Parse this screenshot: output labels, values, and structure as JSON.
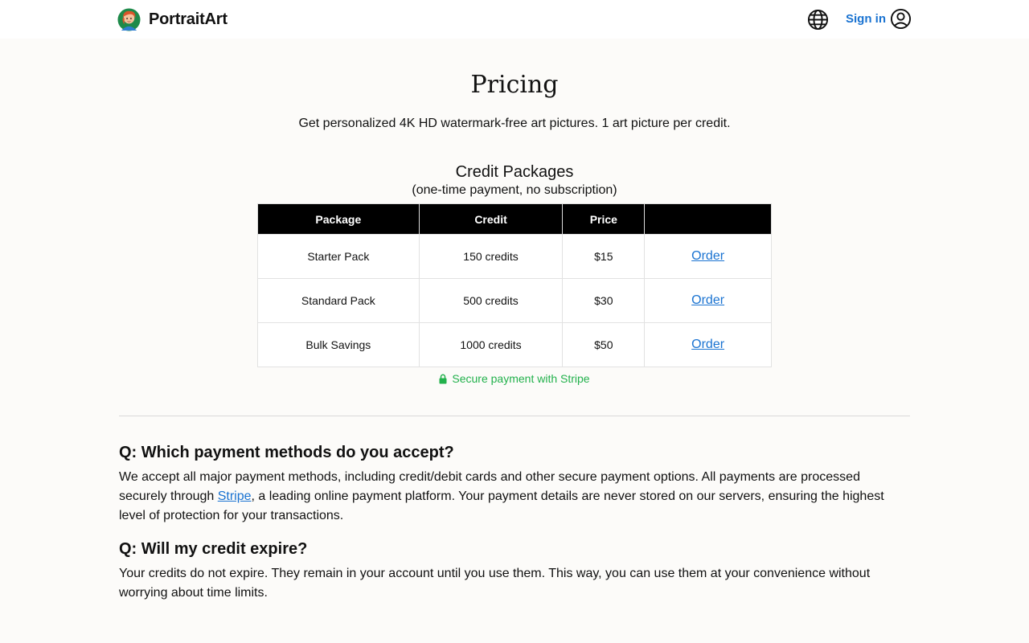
{
  "header": {
    "brand": "PortraitArt",
    "signin_label": "Sign in",
    "icons": [
      "portrait-logo-icon",
      "globe-icon",
      "user-circle-icon"
    ]
  },
  "page": {
    "title": "Pricing",
    "subtitle": "Get personalized 4K HD watermark-free art pictures. 1 art picture per credit."
  },
  "packages": {
    "title": "Credit Packages",
    "subtitle": "(one-time payment, no subscription)",
    "columns": [
      "Package",
      "Credit",
      "Price",
      ""
    ],
    "rows": [
      {
        "package": "Starter Pack",
        "credit": "150 credits",
        "price": "$15",
        "action": "Order"
      },
      {
        "package": "Standard Pack",
        "credit": "500 credits",
        "price": "$30",
        "action": "Order"
      },
      {
        "package": "Bulk Savings",
        "credit": "1000 credits",
        "price": "$50",
        "action": "Order"
      }
    ],
    "secure_text": "Secure payment with Stripe"
  },
  "faq": [
    {
      "question": "Q: Which payment methods do you accept?",
      "answer_before": "We accept all major payment methods, including credit/debit cards and other secure payment options. All payments are processed securely through ",
      "answer_link": "Stripe",
      "answer_after": ", a leading online payment platform. Your payment details are never stored on our servers, ensuring the highest level of protection for your transactions."
    },
    {
      "question": "Q: Will my credit expire?",
      "answer": "Your credits do not expire. They remain in your account until you use them. This way, you can use them at your convenience without worrying about time limits."
    }
  ],
  "colors": {
    "accent": "#1a73d1",
    "secure_green": "#22b14c",
    "table_header": "#000000",
    "background": "#fcfbf9"
  }
}
